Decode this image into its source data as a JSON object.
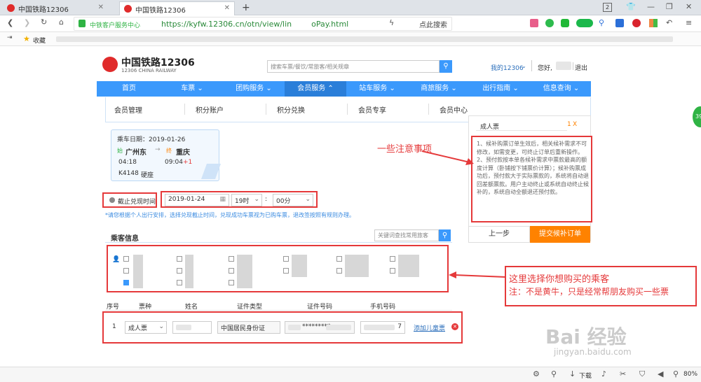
{
  "browser": {
    "tabs": [
      {
        "label": "中国铁路12306",
        "active": false
      },
      {
        "label": "中国铁路12306",
        "active": true
      }
    ],
    "new_tab": "+",
    "tab_count": "2",
    "site_badge": "中铁客户服务中心",
    "url": "https://kyfw.12306.cn/otn/view/lin        oPay.html",
    "search_text": "点此搜索",
    "bookmark_label": "收藏",
    "status": {
      "download": "下载",
      "zoom": "80%"
    }
  },
  "site": {
    "logo_text": "中国铁路12306",
    "logo_sub": "12306 CHINA RAILWAY",
    "search_placeholder": "搜索车票/餐饮/常旅客/相关规章",
    "my12306": "我的12306",
    "greeting": "您好,",
    "logout": "退出"
  },
  "nav": [
    {
      "label": "首页"
    },
    {
      "label": "车票 ⌄"
    },
    {
      "label": "团购服务 ⌄"
    },
    {
      "label": "会员服务 ⌃"
    },
    {
      "label": "站车服务 ⌄"
    },
    {
      "label": "商旅服务 ⌄"
    },
    {
      "label": "出行指南 ⌄"
    },
    {
      "label": "信息查询 ⌄"
    }
  ],
  "subnav": [
    "会员管理",
    "积分账户",
    "积分兑换",
    "会员专享",
    "会员中心"
  ],
  "trip": {
    "date": "乘车日期：2019-01-26",
    "from_tag": "始",
    "from": "广州东",
    "arrow": "→",
    "to_tag": "终",
    "to": "重庆",
    "dep_time": "04:18",
    "arr_time": "09:04",
    "plus_day": "+1",
    "train": "K4148",
    "seat": "硬座"
  },
  "deadline": {
    "label": "截止兑现时间",
    "date": "2019-01-24",
    "hour": "19时",
    "colon": ":",
    "minute": "00分",
    "note": "*请您根据个人出行安排，选择兑现截止时间，兑现成功车票视为已购车票，退改签按照有规则办理。"
  },
  "passengers": {
    "title": "乘客信息",
    "search_placeholder": "关键词查找常用旅客",
    "table_headers": [
      "序号",
      "票种",
      "姓名",
      "证件类型",
      "证件号码",
      "手机号码"
    ],
    "row": {
      "index": "1",
      "ticket_type": "成人票",
      "id_type": "中国居民身份证",
      "id_number": "*********",
      "phone_suffix": "7",
      "add_child": "添加儿童票"
    }
  },
  "side_panel": {
    "ticket_type": "成人票",
    "count": "1",
    "count_unit": "X",
    "notes": "1、候补购票订单生效后，相关候补需求不可修改，如需变更，可终止订单后重新操作。\n2、预付款按本单各候补需求中票款最高的额度计算（卧铺按下铺票价计算）；候补购票成功后，预付款大于实际票款的，系统将自动退回差额票款。用户主动终止或系统自动终止候补的，系统自动全额退还预付款。",
    "prev_button": "上一步",
    "submit_button": "提交候补订单"
  },
  "annotations": {
    "notice": "一些注意事项",
    "select_passenger_line1": "这里选择你想购买的乘客",
    "select_passenger_line2": "注：不是黄牛，只是经常帮朋友购买一些票"
  },
  "watermark": {
    "logo": "Bai 经验",
    "url": "jingyan.baidu.com"
  },
  "colors": {
    "nav_blue": "#3b99fc",
    "annotation_red": "#e5393a",
    "submit_orange": "#ff8200"
  }
}
